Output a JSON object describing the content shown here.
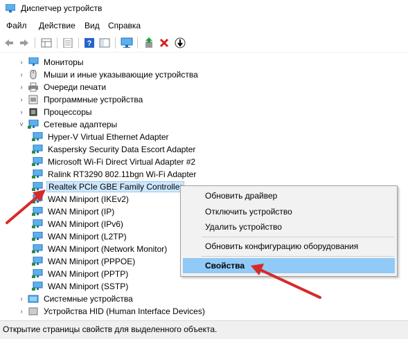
{
  "window": {
    "title": "Диспетчер устройств"
  },
  "menu": [
    "Файл",
    "Действие",
    "Вид",
    "Справка"
  ],
  "toolbar": {
    "icons": [
      "back-icon",
      "forward-icon",
      "properties-grid-icon",
      "document-icon",
      "help-icon",
      "show-pane-icon",
      "monitor-scan-icon",
      "update-driver-icon",
      "uninstall-x-icon",
      "download-arrow-icon"
    ]
  },
  "tree": [
    {
      "label": "Мониторы",
      "expanded": false,
      "icon": "monitor-icon"
    },
    {
      "label": "Мыши и иные указывающие устройства",
      "expanded": false,
      "icon": "mouse-icon"
    },
    {
      "label": "Очереди печати",
      "expanded": false,
      "icon": "printer-icon"
    },
    {
      "label": "Программные устройства",
      "expanded": false,
      "icon": "software-device-icon"
    },
    {
      "label": "Процессоры",
      "expanded": false,
      "icon": "cpu-icon"
    },
    {
      "label": "Сетевые адаптеры",
      "expanded": true,
      "icon": "network-adapter-icon"
    },
    {
      "label": "Hyper-V Virtual Ethernet Adapter",
      "child": true,
      "icon": "network-adapter-icon"
    },
    {
      "label": "Kaspersky Security Data Escort Adapter",
      "child": true,
      "icon": "network-adapter-icon"
    },
    {
      "label": "Microsoft Wi-Fi Direct Virtual Adapter #2",
      "child": true,
      "icon": "network-adapter-icon"
    },
    {
      "label": "Ralink RT3290 802.11bgn Wi-Fi Adapter",
      "child": true,
      "icon": "network-adapter-icon"
    },
    {
      "label": "Realtek PCIe GBE Family Controller",
      "child": true,
      "selected": true,
      "icon": "network-adapter-icon"
    },
    {
      "label": "WAN Miniport (IKEv2)",
      "child": true,
      "icon": "network-adapter-icon"
    },
    {
      "label": "WAN Miniport (IP)",
      "child": true,
      "icon": "network-adapter-icon"
    },
    {
      "label": "WAN Miniport (IPv6)",
      "child": true,
      "icon": "network-adapter-icon"
    },
    {
      "label": "WAN Miniport (L2TP)",
      "child": true,
      "icon": "network-adapter-icon"
    },
    {
      "label": "WAN Miniport (Network Monitor)",
      "child": true,
      "icon": "network-adapter-icon"
    },
    {
      "label": "WAN Miniport (PPPOE)",
      "child": true,
      "icon": "network-adapter-icon"
    },
    {
      "label": "WAN Miniport (PPTP)",
      "child": true,
      "icon": "network-adapter-icon"
    },
    {
      "label": "WAN Miniport (SSTP)",
      "child": true,
      "icon": "network-adapter-icon"
    },
    {
      "label": "Системные устройства",
      "expanded": false,
      "icon": "system-device-icon"
    },
    {
      "label": "Устройства HID (Human Interface Devices)",
      "expanded": false,
      "icon": "hid-icon"
    }
  ],
  "context_menu": {
    "items": [
      {
        "label": "Обновить драйвер"
      },
      {
        "label": "Отключить устройство"
      },
      {
        "label": "Удалить устройство"
      },
      {
        "separator": true
      },
      {
        "label": "Обновить конфигурацию оборудования"
      },
      {
        "separator": true
      },
      {
        "label": "Свойства",
        "highlighted": true
      }
    ]
  },
  "status": {
    "text": "Открытие страницы свойств для выделенного объекта."
  },
  "colors": {
    "selection": "#cce8ff",
    "menu_highlight": "#91c9f7",
    "arrow": "#d62a2a"
  }
}
